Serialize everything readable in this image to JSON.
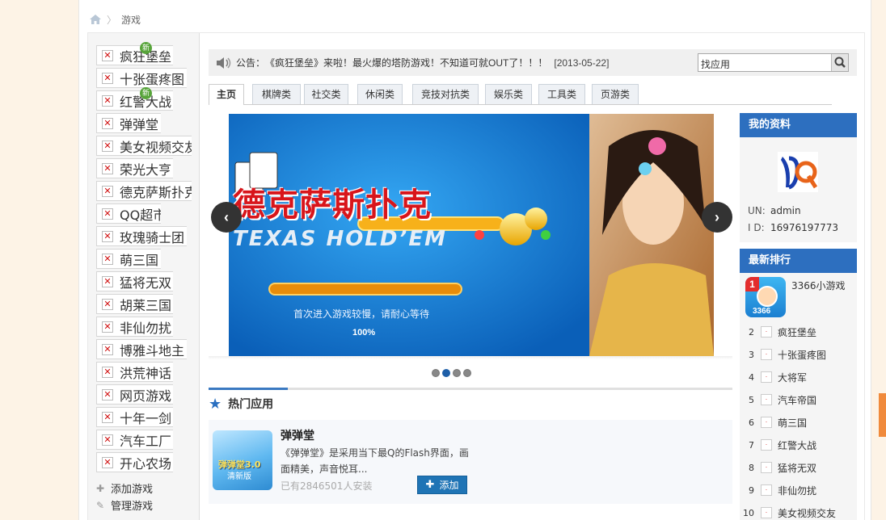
{
  "breadcrumb": {
    "current": "游戏"
  },
  "left_games": [
    {
      "name": "疯狂堡垒",
      "is_new": true,
      "new_label": "新",
      "w": 95
    },
    {
      "name": "十张蛋疼图",
      "is_new": false,
      "w": 112
    },
    {
      "name": "红警大战",
      "is_new": true,
      "new_label": "新",
      "w": 95
    },
    {
      "name": "弹弹堂",
      "is_new": false,
      "w": 80
    },
    {
      "name": "美女视频交友",
      "is_new": false,
      "w": 118
    },
    {
      "name": "荣光大亨",
      "is_new": false,
      "w": 95
    },
    {
      "name": "德克萨斯扑克",
      "is_new": false,
      "w": 118
    },
    {
      "name": "QQ超市",
      "is_new": false,
      "w": 80
    },
    {
      "name": "玫瑰骑士团",
      "is_new": false,
      "w": 112
    },
    {
      "name": "萌三国",
      "is_new": false,
      "w": 80
    },
    {
      "name": "猛将无双",
      "is_new": false,
      "w": 95
    },
    {
      "name": "胡莱三国",
      "is_new": false,
      "w": 95
    },
    {
      "name": "非仙勿扰",
      "is_new": false,
      "w": 95
    },
    {
      "name": "博雅斗地主",
      "is_new": false,
      "w": 112
    },
    {
      "name": "洪荒神话",
      "is_new": false,
      "w": 95
    },
    {
      "name": "网页游戏",
      "is_new": false,
      "w": 95
    },
    {
      "name": "十年一剑",
      "is_new": false,
      "w": 95
    },
    {
      "name": "汽车工厂",
      "is_new": false,
      "w": 95
    },
    {
      "name": "开心农场",
      "is_new": false,
      "w": 95
    }
  ],
  "left_actions": {
    "add": "添加游戏",
    "manage": "管理游戏"
  },
  "notice": {
    "label": "公告：",
    "text": "《疯狂堡垒》来啦！最火爆的塔防游戏！不知道可就OUT了！！！",
    "date": "[2013-05-22]"
  },
  "search": {
    "value": "找应用"
  },
  "tabs": [
    "主页",
    "棋牌类",
    "社交类",
    "休闲类",
    "竞技对抗类",
    "娱乐类",
    "工具类",
    "页游类"
  ],
  "active_tab": "主页",
  "banner": {
    "title": "德克萨斯扑克",
    "subtitle": "TEXAS HOLD’EM",
    "loading_text": "首次进入游戏较慢，请耐心等待",
    "progress_percent": 100,
    "progress_label": "100%",
    "slide_count": 4,
    "active_slide": 2
  },
  "hot": {
    "title": "热门应用",
    "app": {
      "name": "弹弹堂",
      "desc": "《弹弹堂》是采用当下最Q的Flash界面，画面精美，声音悦耳...",
      "installs": "已有2846501人安装",
      "add_label": "添加",
      "icon_text": "弹弹堂3.0",
      "icon_sub": "清新版"
    }
  },
  "profile": {
    "header": "我的资料",
    "un_label": "UN:",
    "un": "admin",
    "id_label": "I D:",
    "id": "16976197773"
  },
  "ranking": {
    "header": "最新排行",
    "first": {
      "rank": "1",
      "name": "3366小游戏",
      "icon_label": "3366"
    },
    "items": [
      {
        "rank": "2",
        "name": "疯狂堡垒"
      },
      {
        "rank": "3",
        "name": "十张蛋疼图"
      },
      {
        "rank": "4",
        "name": "大将军"
      },
      {
        "rank": "5",
        "name": "汽车帝国"
      },
      {
        "rank": "6",
        "name": "萌三国"
      },
      {
        "rank": "7",
        "name": "红警大战"
      },
      {
        "rank": "8",
        "name": "猛将无双"
      },
      {
        "rank": "9",
        "name": "非仙勿扰"
      },
      {
        "rank": "10",
        "name": "美女视频交友"
      }
    ]
  },
  "colors": {
    "accent": "#2d6fbf",
    "banner_blue": "#1a7fd8",
    "banner_red": "#d8151b"
  }
}
